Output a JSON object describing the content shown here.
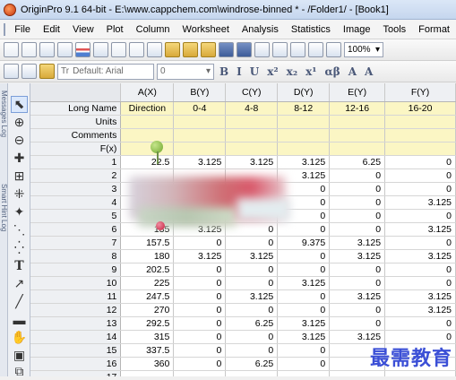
{
  "window": {
    "title": "OriginPro 9.1 64-bit - E:\\www.cappchem.com\\windrose-binned * - /Folder1/ - [Book1]"
  },
  "menu": [
    "File",
    "Edit",
    "View",
    "Plot",
    "Column",
    "Worksheet",
    "Analysis",
    "Statistics",
    "Image",
    "Tools",
    "Format"
  ],
  "toolbar": {
    "zoom": "100%"
  },
  "format_bar": {
    "font": "Default: Arial",
    "size": "0",
    "buttons": [
      "B",
      "I",
      "U",
      "x²",
      "x₂",
      "x¹",
      "αβ",
      "A",
      "A"
    ]
  },
  "side_tabs": {
    "messages": "Messages Log",
    "hints": "Smart Hint Log"
  },
  "tools": [
    "pointer",
    "zoom-in",
    "zoom-out",
    "data-reader",
    "screen-reader",
    "scale",
    "draw-data",
    "data-selector",
    "mask",
    "text",
    "arrow",
    "line",
    "rectangle",
    "hand",
    "insert",
    "layer"
  ],
  "sheet": {
    "columns": [
      "A(X)",
      "B(Y)",
      "C(Y)",
      "D(Y)",
      "E(Y)",
      "F(Y)"
    ],
    "meta_rows": [
      {
        "label": "Long Name",
        "values": [
          "Direction",
          "0-4",
          "4-8",
          "8-12",
          "12-16",
          "16-20"
        ]
      },
      {
        "label": "Units",
        "values": [
          "",
          "",
          "",
          "",
          "",
          ""
        ]
      },
      {
        "label": "Comments",
        "values": [
          "",
          "",
          "",
          "",
          "",
          ""
        ]
      },
      {
        "label": "F(x)",
        "values": [
          "",
          "",
          "",
          "",
          "",
          ""
        ]
      }
    ],
    "rows": [
      {
        "n": "1",
        "c": [
          "22.5",
          "3.125",
          "3.125",
          "3.125",
          "6.25",
          "0"
        ]
      },
      {
        "n": "2",
        "c": [
          "",
          "",
          "",
          "3.125",
          "0",
          "0"
        ]
      },
      {
        "n": "3",
        "c": [
          "",
          "",
          "",
          "0",
          "0",
          "0"
        ]
      },
      {
        "n": "4",
        "c": [
          "",
          "",
          "",
          "0",
          "0",
          "3.125"
        ]
      },
      {
        "n": "5",
        "c": [
          "",
          "",
          "",
          "0",
          "0",
          "0"
        ]
      },
      {
        "n": "6",
        "c": [
          "135",
          "3.125",
          "0",
          "0",
          "0",
          "3.125"
        ]
      },
      {
        "n": "7",
        "c": [
          "157.5",
          "0",
          "0",
          "9.375",
          "3.125",
          "0"
        ]
      },
      {
        "n": "8",
        "c": [
          "180",
          "3.125",
          "3.125",
          "0",
          "3.125",
          "3.125"
        ]
      },
      {
        "n": "9",
        "c": [
          "202.5",
          "0",
          "0",
          "0",
          "0",
          "0"
        ]
      },
      {
        "n": "10",
        "c": [
          "225",
          "0",
          "0",
          "3.125",
          "0",
          "0"
        ]
      },
      {
        "n": "11",
        "c": [
          "247.5",
          "0",
          "3.125",
          "0",
          "3.125",
          "3.125"
        ]
      },
      {
        "n": "12",
        "c": [
          "270",
          "0",
          "0",
          "0",
          "0",
          "3.125"
        ]
      },
      {
        "n": "13",
        "c": [
          "292.5",
          "0",
          "6.25",
          "3.125",
          "0",
          "0"
        ]
      },
      {
        "n": "14",
        "c": [
          "315",
          "0",
          "0",
          "3.125",
          "3.125",
          "0"
        ]
      },
      {
        "n": "15",
        "c": [
          "337.5",
          "0",
          "0",
          "0",
          "",
          ""
        ]
      },
      {
        "n": "16",
        "c": [
          "360",
          "0",
          "6.25",
          "0",
          "",
          ""
        ]
      },
      {
        "n": "17",
        "c": [
          "",
          "",
          "",
          "",
          "",
          ""
        ]
      }
    ]
  },
  "watermark": "最需教育",
  "colors": {
    "title_bar": "#c5d6ee",
    "meta_row": "#fbf6c4",
    "pin_green": "#8bc34a",
    "pin_red": "#d9364a",
    "watermark": "#3b4fd6"
  }
}
